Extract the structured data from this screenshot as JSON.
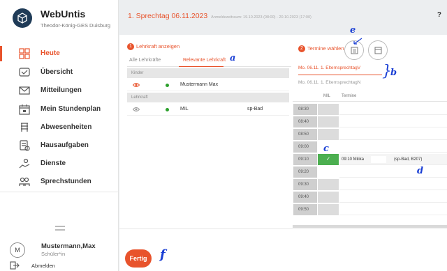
{
  "app": {
    "name": "WebUntis",
    "school": "Theodor-König-GES Duisburg"
  },
  "nav": {
    "items": [
      {
        "label": "Heute",
        "icon": "dashboard-icon",
        "active": true
      },
      {
        "label": "Übersicht",
        "icon": "overview-icon"
      },
      {
        "label": "Mitteilungen",
        "icon": "mail-icon"
      },
      {
        "label": "Mein Stundenplan",
        "icon": "calendar-icon"
      },
      {
        "label": "Abwesenheiten",
        "icon": "absence-icon"
      },
      {
        "label": "Hausaufgaben",
        "icon": "homework-icon"
      },
      {
        "label": "Dienste",
        "icon": "duties-icon"
      },
      {
        "label": "Sprechstunden",
        "icon": "consultation-icon"
      }
    ]
  },
  "user": {
    "avatar_letter": "M",
    "name": "Mustermann,Max",
    "role": "Schüler*in",
    "logout_label": "Abmelden"
  },
  "header": {
    "title": "1. Sprechtag",
    "date": "06.11.2023",
    "registration": "Anmeldezeitraum: 19.10.2023 (08:00) - 20.10.2023 (17:00)",
    "help": "?"
  },
  "left": {
    "section_num": "1",
    "section_title": "Lehrkraft anzeigen",
    "tabs": [
      "Alle Lehrkräfte",
      "Relevante Lehrkraft"
    ],
    "group_children": "Kinder",
    "child_name": "Mustermann Max",
    "group_teachers": "Lehrkraft",
    "teacher_name": "MIL",
    "teacher_extra": "sp-Bad"
  },
  "right": {
    "section_num": "2",
    "section_title": "Termine wählen",
    "event_active": "Mo. 06.11. 1. ElternsprechtagV",
    "event_inactive": "Mo. 06.11. 1. ElternsprechtagN",
    "col_teacher": "MIL",
    "col_appointments": "Termine",
    "times": [
      "08:30",
      "08:40",
      "08:50",
      "09:00",
      "09:10",
      "09:20",
      "09:30",
      "09:40",
      "09:50"
    ],
    "booked_time": "09:10",
    "booked_check": "✓",
    "booked_text": "09:10 Milika",
    "booked_room": "(sp-Bad, B207)"
  },
  "footer": {
    "done_label": "Fertig"
  },
  "annotations": {
    "a": "a",
    "b": "b",
    "c": "c",
    "d": "d",
    "e": "e",
    "f": "f",
    "brace": "}"
  },
  "colors": {
    "accent": "#e8532c",
    "success": "#4caf50",
    "brand": "#1f3b57"
  }
}
